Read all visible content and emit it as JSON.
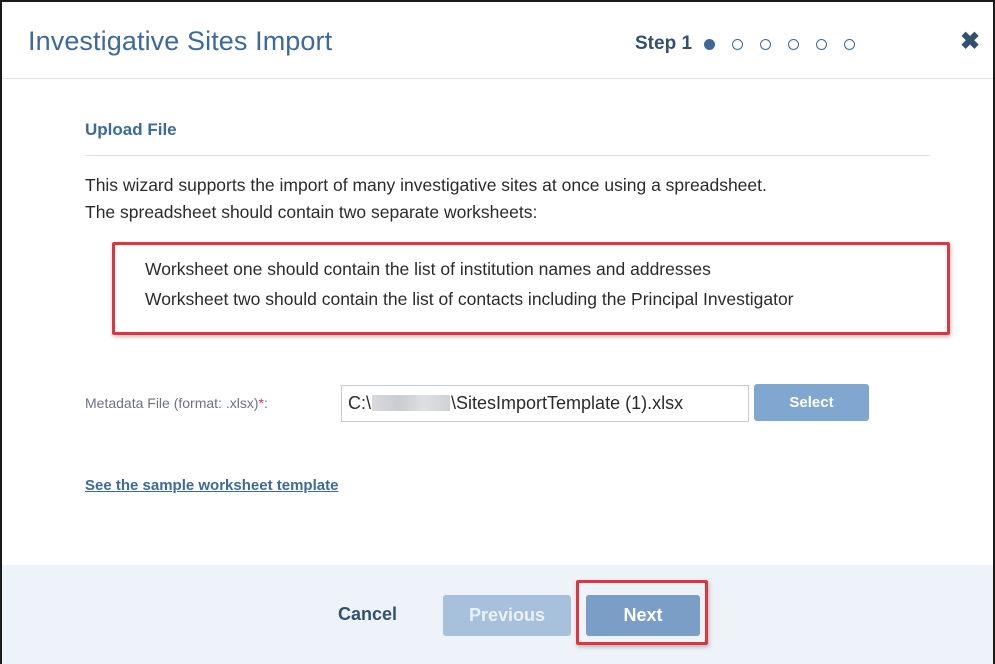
{
  "dialog": {
    "title": "Investigative Sites Import",
    "step_label": "Step 1",
    "steps": [
      {
        "state": "active"
      },
      {
        "state": "inactive"
      },
      {
        "state": "inactive"
      },
      {
        "state": "inactive"
      },
      {
        "state": "inactive"
      },
      {
        "state": "inactive"
      }
    ],
    "close_icon": "close-icon",
    "close_glyph": "✖"
  },
  "upload": {
    "section_title": "Upload File",
    "intro_line1": "This wizard supports the import of many investigative sites at once using a spreadsheet.",
    "intro_line2": "The spreadsheet should contain two separate worksheets:",
    "worksheet_line1": "Worksheet one should contain the list of institution names and addresses",
    "worksheet_line2": "Worksheet two should contain the list of contacts including the Principal Investigator"
  },
  "metadata": {
    "label": "Metadata File (format: .xlsx)",
    "required_marker": "*",
    "label_suffix": ":",
    "file_prefix": "C:\\",
    "file_suffix": "\\SitesImportTemplate (1).xlsx",
    "select_label": "Select"
  },
  "sample_link": "See the sample worksheet template",
  "footer": {
    "cancel_label": "Cancel",
    "previous_label": "Previous",
    "next_label": "Next"
  },
  "colors": {
    "accent": "#3d6a99",
    "highlight": "#e0343f",
    "footer_bg": "#eef3f9"
  }
}
